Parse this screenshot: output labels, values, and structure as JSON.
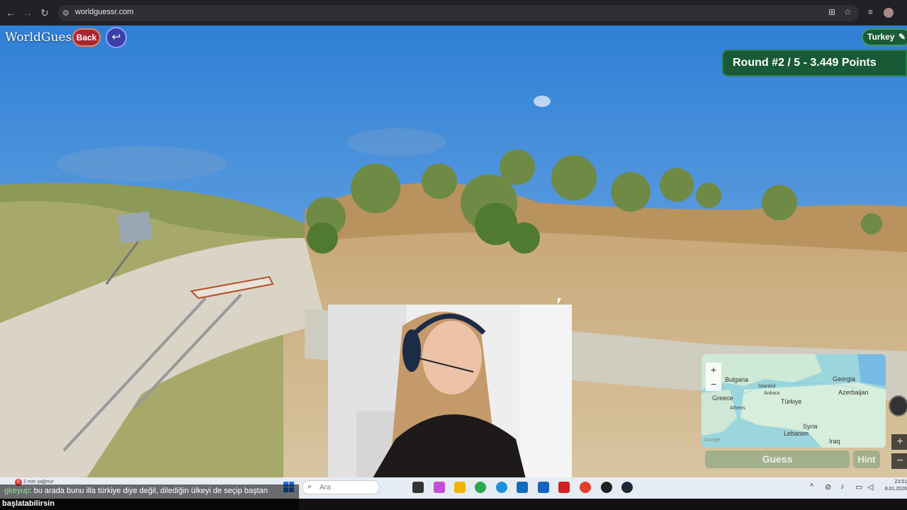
{
  "browser": {
    "url": "worldguessr.com",
    "back_icon": "arrow-left-icon",
    "forward_icon": "arrow-right-icon",
    "reload_icon": "reload-icon"
  },
  "game": {
    "brand": "WorldGuessr",
    "back_label": "Back",
    "country": "Turkey",
    "round_text": "Round #2 / 5 - 3.449 Points",
    "guess_label": "Guess",
    "hint_label": "Hint",
    "map_labels": {
      "bulgaria": "Bulgaria",
      "istanbul": "İstanbul",
      "ankara": "Ankara",
      "turkiye": "Türkiye",
      "georgia": "Georgia",
      "azerbaijan": "Azerbaijan",
      "greece": "Greece",
      "athens": "Athens",
      "syria": "Syria",
      "lebanon": "Lebanon",
      "iraq": "Iraq",
      "google": "Google"
    },
    "zoom_in": "+",
    "zoom_out": "−"
  },
  "chat": {
    "username": "gkeyup",
    "message": ": bu arada bunu illa türkiye diye değil, dilediğin ülkeyi de seçip baştan",
    "message_cont": "başlatabilirsin"
  },
  "taskbar": {
    "weather": "2 mm yağmur",
    "weather_badge": "6",
    "search_placeholder": "Ara",
    "time": "23:51",
    "date": "8.01.2026"
  },
  "colors": {
    "round_banner": "#195a36",
    "back_button": "#a8252f",
    "undo_button": "#3c3fa6",
    "sky": "#3a86d6"
  }
}
